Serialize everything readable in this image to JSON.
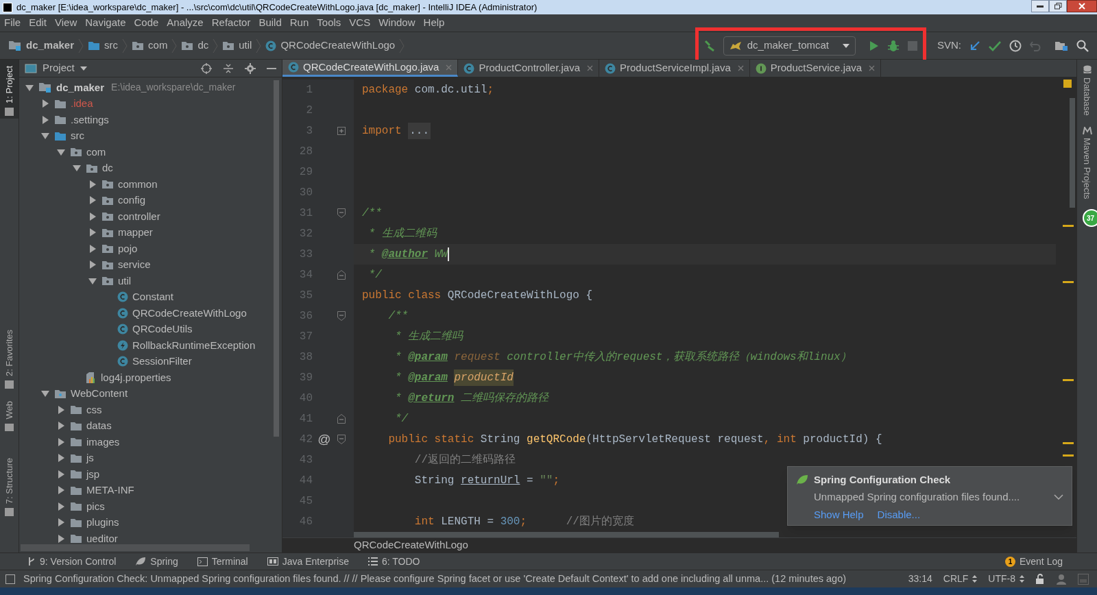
{
  "window": {
    "title": "dc_maker [E:\\idea_workspare\\dc_maker] - ...\\src\\com\\dc\\util\\QRCodeCreateWithLogo.java [dc_maker] - IntelliJ IDEA (Administrator)"
  },
  "menu": [
    "File",
    "Edit",
    "View",
    "Navigate",
    "Code",
    "Analyze",
    "Refactor",
    "Build",
    "Run",
    "Tools",
    "VCS",
    "Window",
    "Help"
  ],
  "breadcrumbs": [
    {
      "label": "dc_maker",
      "kind": "module"
    },
    {
      "label": "src",
      "kind": "source_folder"
    },
    {
      "label": "com",
      "kind": "package"
    },
    {
      "label": "dc",
      "kind": "package"
    },
    {
      "label": "util",
      "kind": "package"
    },
    {
      "label": "QRCodeCreateWithLogo",
      "kind": "class"
    }
  ],
  "toolbar": {
    "highlighted": true,
    "run_config": "dc_maker_tomcat",
    "stop_enabled": false,
    "svn_label": "SVN:",
    "revert_enabled": false
  },
  "left_stripe": [
    {
      "label": "1: Project",
      "selected": true
    },
    {
      "label": "2: Favorites",
      "selected": false
    },
    {
      "label": "Web",
      "selected": false
    },
    {
      "label": "7: Structure",
      "selected": false
    }
  ],
  "project": {
    "title": "Project",
    "tree": [
      {
        "label": "dc_maker",
        "path": "E:\\idea_workspare\\dc_maker",
        "kind": "module",
        "expanded": true,
        "children": [
          {
            "label": ".idea",
            "kind": "folder",
            "excluded": true,
            "expanded": false
          },
          {
            "label": ".settings",
            "kind": "folder",
            "excluded": false,
            "expanded": false
          },
          {
            "label": "src",
            "kind": "source_folder",
            "excluded": false,
            "expanded": true,
            "children": [
              {
                "label": "com",
                "kind": "package",
                "expanded": true,
                "children": [
                  {
                    "label": "dc",
                    "kind": "package",
                    "expanded": true,
                    "children": [
                      {
                        "label": "common",
                        "kind": "package",
                        "expanded": false
                      },
                      {
                        "label": "config",
                        "kind": "package",
                        "expanded": false
                      },
                      {
                        "label": "controller",
                        "kind": "package",
                        "expanded": false
                      },
                      {
                        "label": "mapper",
                        "kind": "package",
                        "expanded": false
                      },
                      {
                        "label": "pojo",
                        "kind": "package",
                        "expanded": false
                      },
                      {
                        "label": "service",
                        "kind": "package",
                        "expanded": false
                      },
                      {
                        "label": "util",
                        "kind": "package",
                        "expanded": true,
                        "children": [
                          {
                            "label": "Constant",
                            "kind": "class"
                          },
                          {
                            "label": "QRCodeCreateWithLogo",
                            "kind": "class"
                          },
                          {
                            "label": "QRCodeUtils",
                            "kind": "class"
                          },
                          {
                            "label": "RollbackRuntimeException",
                            "kind": "exception"
                          },
                          {
                            "label": "SessionFilter",
                            "kind": "class"
                          }
                        ]
                      }
                    ]
                  },
                  {
                    "label": "log4j.properties",
                    "kind": "properties"
                  }
                ]
              }
            ]
          },
          {
            "label": "WebContent",
            "kind": "web_folder",
            "excluded": false,
            "expanded": true,
            "children": [
              {
                "label": "css",
                "kind": "folder",
                "expanded": false
              },
              {
                "label": "datas",
                "kind": "folder",
                "expanded": false
              },
              {
                "label": "images",
                "kind": "folder",
                "expanded": false
              },
              {
                "label": "js",
                "kind": "folder",
                "expanded": false
              },
              {
                "label": "jsp",
                "kind": "folder",
                "expanded": false
              },
              {
                "label": "META-INF",
                "kind": "folder",
                "expanded": false
              },
              {
                "label": "pics",
                "kind": "folder",
                "expanded": false
              },
              {
                "label": "plugins",
                "kind": "folder",
                "expanded": false
              },
              {
                "label": "ueditor",
                "kind": "folder",
                "expanded": false
              }
            ]
          }
        ]
      }
    ]
  },
  "editor_tabs": [
    {
      "label": "QRCodeCreateWithLogo.java",
      "kind": "class",
      "selected": true
    },
    {
      "label": "ProductController.java",
      "kind": "class",
      "selected": false
    },
    {
      "label": "ProductServiceImpl.java",
      "kind": "class",
      "selected": false
    },
    {
      "label": "ProductService.java",
      "kind": "interface",
      "selected": false
    }
  ],
  "code_lines": [
    {
      "number": "1",
      "tokens": [
        {
          "kind": "keyword",
          "text": "package"
        },
        {
          "kind": "plain",
          "text": " com.dc.util"
        },
        {
          "kind": "keyword",
          "text": ";"
        }
      ]
    },
    {
      "number": "2"
    },
    {
      "number": "3",
      "kind": "fold_expand",
      "tokens": [
        {
          "kind": "keyword",
          "text": "import "
        },
        {
          "kind": "folded",
          "text": "..."
        }
      ]
    },
    {
      "number": "28"
    },
    {
      "number": "29"
    },
    {
      "number": "30"
    },
    {
      "number": "31",
      "kind": "fold_start",
      "tokens": [
        {
          "kind": "doc",
          "text": "/**"
        }
      ]
    },
    {
      "number": "32",
      "tokens": [
        {
          "kind": "doc",
          "text": " * 生成二维码"
        }
      ]
    },
    {
      "number": "33",
      "current": true,
      "tokens": [
        {
          "kind": "doc",
          "text": " * "
        },
        {
          "kind": "doc_tag",
          "text": "@author"
        },
        {
          "kind": "doc",
          "text": " WW"
        }
      ]
    },
    {
      "number": "34",
      "kind": "fold_end",
      "tokens": [
        {
          "kind": "doc",
          "text": " */"
        }
      ]
    },
    {
      "number": "35",
      "tokens": [
        {
          "kind": "keyword",
          "text": "public class "
        },
        {
          "kind": "plain",
          "text": "QRCodeCreateWithLogo {"
        }
      ]
    },
    {
      "number": "36",
      "kind": "fold_start",
      "tokens": [
        {
          "kind": "doc",
          "text": "    /**"
        }
      ]
    },
    {
      "number": "37",
      "tokens": [
        {
          "kind": "doc",
          "text": "     * 生成二维吗"
        }
      ]
    },
    {
      "number": "38",
      "tokens": [
        {
          "kind": "doc",
          "text": "     * "
        },
        {
          "kind": "doc_tag",
          "text": "@param"
        },
        {
          "kind": "doc_param",
          "text": " request"
        },
        {
          "kind": "doc",
          "text": " controller中传入的request，获取系统路径（windows和linux）"
        }
      ]
    },
    {
      "number": "39",
      "tokens": [
        {
          "kind": "doc",
          "text": "     * "
        },
        {
          "kind": "doc_tag",
          "text": "@param"
        },
        {
          "kind": "doc_param_marked",
          "text": "productId"
        }
      ]
    },
    {
      "number": "40",
      "tokens": [
        {
          "kind": "doc",
          "text": "     * "
        },
        {
          "kind": "doc_tag",
          "text": "@return"
        },
        {
          "kind": "doc",
          "text": " 二维吗保存的路径"
        }
      ]
    },
    {
      "number": "41",
      "kind": "fold_end",
      "tokens": [
        {
          "kind": "doc",
          "text": "     */"
        }
      ]
    },
    {
      "number": "42",
      "gutter": "@",
      "kind": "fold_start",
      "tokens": [
        {
          "kind": "keyword",
          "text": "    public static "
        },
        {
          "kind": "plain",
          "text": "String "
        },
        {
          "kind": "method",
          "text": "getQRCode"
        },
        {
          "kind": "plain",
          "text": "(HttpServletRequest request"
        },
        {
          "kind": "keyword",
          "text": ", int"
        },
        {
          "kind": "plain",
          "text": " productId) {"
        }
      ]
    },
    {
      "number": "43",
      "tokens": [
        {
          "kind": "comment",
          "text": "        //返回的二维码路径"
        }
      ]
    },
    {
      "number": "44",
      "tokens": [
        {
          "kind": "plain",
          "text": "        String "
        },
        {
          "kind": "var_underlined",
          "text": "returnUrl"
        },
        {
          "kind": "plain",
          "text": " = "
        },
        {
          "kind": "string",
          "text": "\"\""
        },
        {
          "kind": "keyword",
          "text": ";"
        }
      ]
    },
    {
      "number": "45"
    },
    {
      "number": "46",
      "tokens": [
        {
          "kind": "keyword",
          "text": "        int"
        },
        {
          "kind": "plain",
          "text": " LENGTH = "
        },
        {
          "kind": "number",
          "text": "300"
        },
        {
          "kind": "keyword",
          "text": ";"
        },
        {
          "kind": "comment",
          "text": "      //图片的宽度"
        }
      ]
    }
  ],
  "editor_breadcrumb": "QRCodeCreateWithLogo",
  "notification": {
    "title": "Spring Configuration Check",
    "body": "Unmapped Spring configuration files found....",
    "links": [
      "Show Help",
      "Disable..."
    ]
  },
  "right_stripe": [
    {
      "label": "Database",
      "kind": "database"
    },
    {
      "label": "Maven Projects",
      "kind": "maven"
    }
  ],
  "memory_badge": "37",
  "bottom_tools": [
    {
      "label": "9: Version Control",
      "kind": "vcs"
    },
    {
      "label": "Spring",
      "kind": "spring"
    },
    {
      "label": "Terminal",
      "kind": "terminal"
    },
    {
      "label": "Java Enterprise",
      "kind": "enterprise"
    },
    {
      "label": "6: TODO",
      "kind": "todo"
    }
  ],
  "event_log": {
    "label": "Event Log",
    "count": "1"
  },
  "status_bar": {
    "message": "Spring Configuration Check: Unmapped Spring configuration files found. // // Please configure Spring facet or use 'Create Default Context' to add one including all unma... (12 minutes ago)",
    "position": "33:14",
    "line_separator": "CRLF",
    "encoding": "UTF-8"
  }
}
